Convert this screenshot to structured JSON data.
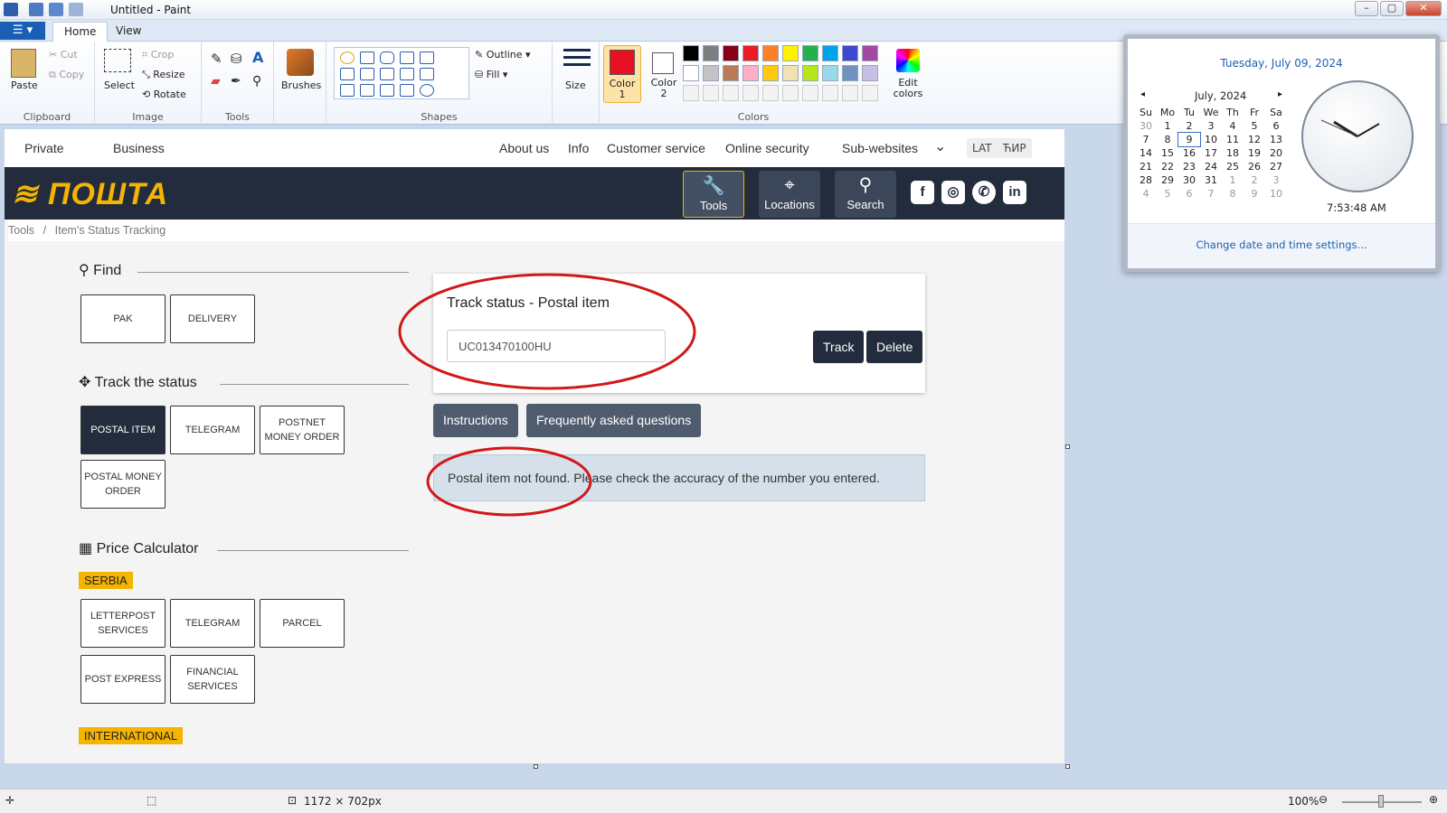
{
  "window": {
    "title": "Untitled - Paint"
  },
  "ribbon": {
    "tabs": [
      "Home",
      "View"
    ],
    "clipboard": {
      "paste": "Paste",
      "cut": "Cut",
      "copy": "Copy",
      "group": "Clipboard"
    },
    "image": {
      "select": "Select",
      "crop": "Crop",
      "resize": "Resize",
      "rotate": "Rotate",
      "group": "Image"
    },
    "tools": {
      "group": "Tools"
    },
    "brushes": "Brushes",
    "shapes": {
      "outline": "Outline",
      "fill": "Fill",
      "group": "Shapes"
    },
    "size": "Size",
    "color1": "Color 1",
    "color2": "Color 2",
    "colors_group": "Colors",
    "edit_colors": "Edit colors",
    "color1_hex": "#e81123",
    "palette": [
      "#000000",
      "#7f7f7f",
      "#880015",
      "#ed1c24",
      "#ff7f27",
      "#fff200",
      "#22b14c",
      "#00a2e8",
      "#3f48cc",
      "#a349a4",
      "#ffffff",
      "#c3c3c3",
      "#b97a57",
      "#ffaec9",
      "#ffc90e",
      "#efe4b0",
      "#b5e61d",
      "#99d9ea",
      "#7092be",
      "#c8bfe7"
    ]
  },
  "site": {
    "topnav": {
      "private": "Private",
      "business": "Business",
      "about": "About us",
      "info": "Info",
      "customer": "Customer service",
      "security": "Online security",
      "subsites": "Sub-websites",
      "lat": "LAT",
      "cyr": "ЋИР"
    },
    "logo": "ПОШТА",
    "banner_buttons": {
      "tools": "Tools",
      "locations": "Locations",
      "search": "Search"
    },
    "social": [
      "f",
      "◎",
      "✆",
      "in"
    ],
    "breadcrumb": {
      "a": "Tools",
      "sep": "/",
      "b": "Item's Status Tracking"
    },
    "find": {
      "title": "Find",
      "items": [
        "PAK",
        "DELIVERY"
      ]
    },
    "track": {
      "title": "Track the status",
      "items": [
        "POSTAL ITEM",
        "TELEGRAM",
        "POSTNET MONEY ORDER",
        "POSTAL MONEY ORDER"
      ]
    },
    "price": {
      "title": "Price Calculator",
      "serbia": "SERBIA",
      "items": [
        "LETTERPOST SERVICES",
        "TELEGRAM",
        "PARCEL",
        "POST EXPRESS",
        "FINANCIAL SERVICES"
      ],
      "international": "INTERNATIONAL"
    },
    "card": {
      "title": "Track status - Postal item",
      "input_value": "UC013470100HU",
      "track": "Track",
      "delete": "Delete"
    },
    "links": {
      "instructions": "Instructions",
      "faq": "Frequently asked questions"
    },
    "alert": "Postal item not found. Please check the accuracy of the number you entered."
  },
  "statusbar": {
    "dimensions": "1172 × 702px",
    "zoom": "100%"
  },
  "clock": {
    "date": "Tuesday, July 09, 2024",
    "month": "July, 2024",
    "weekdays": [
      "Su",
      "Mo",
      "Tu",
      "We",
      "Th",
      "Fr",
      "Sa"
    ],
    "weeks": [
      [
        "30",
        "1",
        "2",
        "3",
        "4",
        "5",
        "6"
      ],
      [
        "7",
        "8",
        "9",
        "10",
        "11",
        "12",
        "13"
      ],
      [
        "14",
        "15",
        "16",
        "17",
        "18",
        "19",
        "20"
      ],
      [
        "21",
        "22",
        "23",
        "24",
        "25",
        "26",
        "27"
      ],
      [
        "28",
        "29",
        "30",
        "31",
        "1",
        "2",
        "3"
      ],
      [
        "4",
        "5",
        "6",
        "7",
        "8",
        "9",
        "10"
      ]
    ],
    "time": "7:53:48 AM",
    "settings": "Change date and time settings..."
  }
}
